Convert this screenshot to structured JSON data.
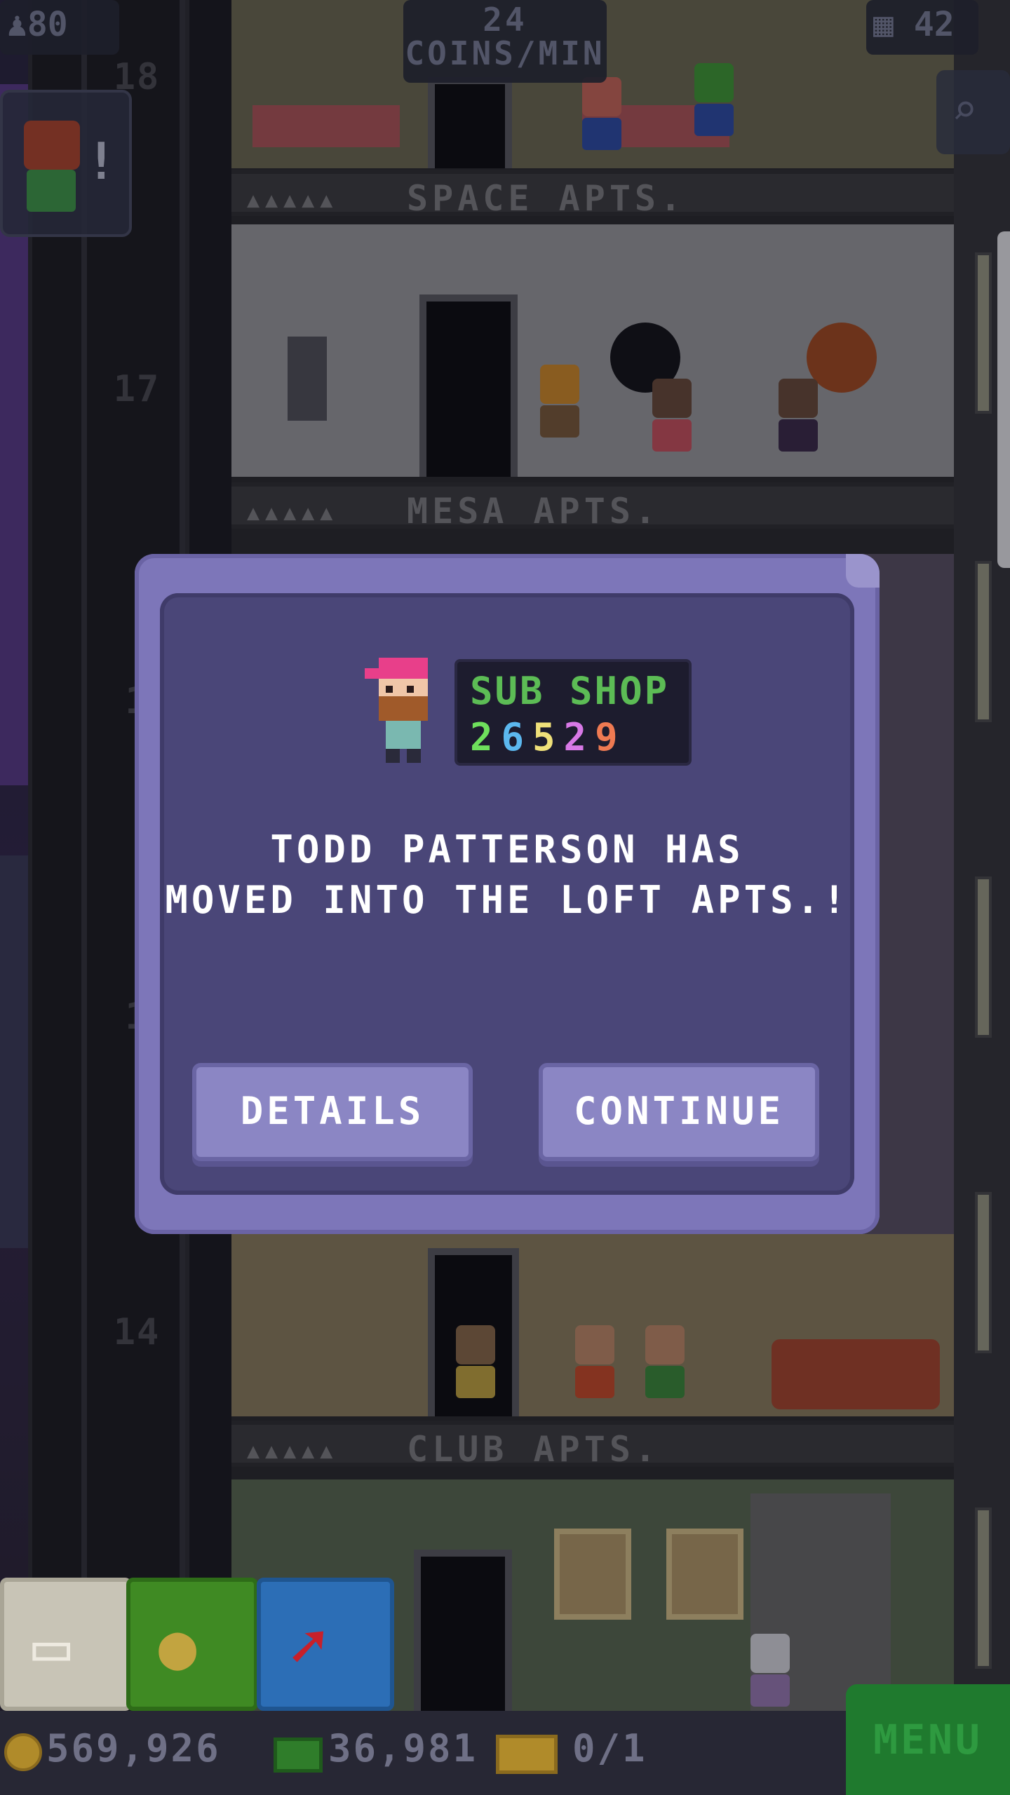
{
  "hud": {
    "population": "80",
    "population_icon": "person-icon",
    "coins_per_min_value": "24",
    "coins_per_min_label": "COINS/MIN",
    "floors": "42",
    "floors_icon": "building-icon",
    "search_icon": "magnifier-icon"
  },
  "notification": {
    "bang": "!"
  },
  "shaft_numbers": [
    "18",
    "17",
    "1",
    "1",
    "14"
  ],
  "floors": [
    {
      "name": "SPACE APTS.",
      "dots": "▲▲▲▲▲"
    },
    {
      "name": "MESA APTS.",
      "dots": "▲▲▲▲▲"
    },
    {
      "name": "CLUB APTS.",
      "dots": "▲▲▲▲▲"
    }
  ],
  "dialog": {
    "business_name": "SUB SHOP",
    "business_digits": [
      {
        "d": "2",
        "color": "#6ee05c"
      },
      {
        "d": "6",
        "color": "#5cb8ef"
      },
      {
        "d": "5",
        "color": "#efe07a"
      },
      {
        "d": "2",
        "color": "#d879e6"
      },
      {
        "d": "9",
        "color": "#ef7a52"
      }
    ],
    "message_line1": "TODD PATTERSON HAS",
    "message_line2": "MOVED INTO THE LOFT APTS.!",
    "details_label": "DETAILS",
    "continue_label": "CONTINUE"
  },
  "bottom": {
    "coins": "569,926",
    "bux": "36,981",
    "tickets": "0/1",
    "menu_label": "MENU"
  },
  "colors": {
    "dialog_frame": "#7d76b9",
    "dialog_panel": "#4a4678",
    "button": "#8b86c4",
    "business_name": "#5cbc55",
    "menu": "#1f7a2e"
  }
}
